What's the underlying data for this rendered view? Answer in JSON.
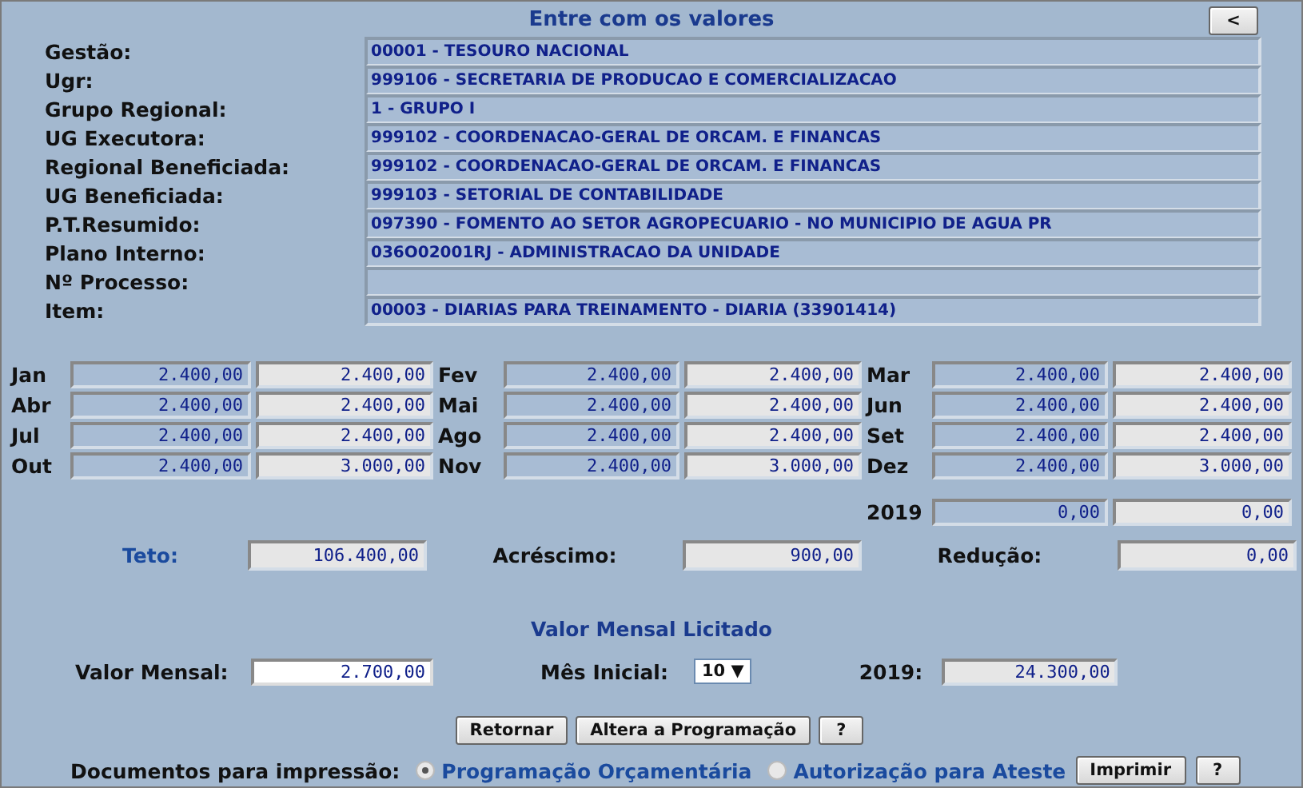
{
  "title": "Entre com os valores",
  "back_button": "<",
  "info_fields": [
    {
      "label": "Gestão:",
      "value": "00001 - TESOURO NACIONAL"
    },
    {
      "label": "Ugr:",
      "value": "999106 - SECRETARIA DE PRODUCAO E COMERCIALIZACAO"
    },
    {
      "label": "Grupo Regional:",
      "value": "1 - GRUPO I"
    },
    {
      "label": "UG Executora:",
      "value": "999102 - COORDENACAO-GERAL DE ORCAM. E FINANCAS"
    },
    {
      "label": "Regional Beneficiada:",
      "value": "999102 - COORDENACAO-GERAL DE ORCAM. E FINANCAS"
    },
    {
      "label": "UG Beneficiada:",
      "value": "999103 - SETORIAL DE CONTABILIDADE"
    },
    {
      "label": "P.T.Resumido:",
      "value": "097390 - FOMENTO AO SETOR AGROPECUARIO - NO MUNICIPIO DE AGUA PR"
    },
    {
      "label": "Plano Interno:",
      "value": "036O02001RJ - ADMINISTRACAO DA UNIDADE"
    },
    {
      "label": "Nº Processo:"
    },
    {
      "label": "Item:",
      "value": "00003 - DIARIAS PARA TREINAMENTO - DIARIA (33901414)"
    }
  ],
  "months": [
    {
      "label": "Jan",
      "value_1": "2.400,00",
      "value_2": "2.400,00"
    },
    {
      "label": "Fev",
      "value_1": "2.400,00",
      "value_2": "2.400,00"
    },
    {
      "label": "Mar",
      "value_1": "2.400,00",
      "value_2": "2.400,00"
    },
    {
      "label": "Abr",
      "value_1": "2.400,00",
      "value_2": "2.400,00"
    },
    {
      "label": "Mai",
      "value_1": "2.400,00",
      "value_2": "2.400,00"
    },
    {
      "label": "Jun",
      "value_1": "2.400,00",
      "value_2": "2.400,00"
    },
    {
      "label": "Jul",
      "value_1": "2.400,00",
      "value_2": "2.400,00"
    },
    {
      "label": "Ago",
      "value_1": "2.400,00",
      "value_2": "2.400,00"
    },
    {
      "label": "Set",
      "value_1": "2.400,00",
      "value_2": "2.400,00"
    },
    {
      "label": "Out",
      "value_1": "2.400,00",
      "value_2": "3.000,00"
    },
    {
      "label": "Nov",
      "value_1": "2.400,00",
      "value_2": "3.000,00"
    },
    {
      "label": "Dez",
      "value_1": "2.400,00",
      "value_2": "3.000,00"
    }
  ],
  "year_row": {
    "label": "2019",
    "value_1": "0,00",
    "value_2": "0,00"
  },
  "totals": [
    {
      "label": "Teto:",
      "value": "106.400,00",
      "highlight": true
    },
    {
      "label": "Acréscimo:",
      "value": "900,00",
      "highlight": false
    },
    {
      "label": "Redução:",
      "value": "0,00",
      "highlight": false
    }
  ],
  "section_title": "Valor Mensal Licitado",
  "valor_mensal": {
    "label": "Valor Mensal:",
    "value": "2.700,00"
  },
  "mes_inicial": {
    "label": "Mês Inicial:",
    "value": "10",
    "arrow": "▼"
  },
  "year_total": {
    "label": "2019:",
    "value": "24.300,00"
  },
  "buttons": [
    "Retornar",
    "Altera a Programação",
    "?"
  ],
  "print": {
    "label": "Documentos para impressão:",
    "options": [
      {
        "label": "Programação Orçamentária",
        "selected": true
      },
      {
        "label": "Autorização para Ateste",
        "selected": false
      }
    ],
    "buttons": [
      "Imprimir",
      "?"
    ]
  }
}
